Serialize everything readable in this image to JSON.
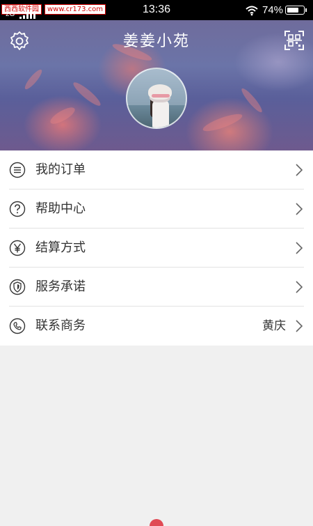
{
  "status_bar": {
    "watermark_badge": "西西软件园",
    "watermark_url": "www.cr173.com",
    "network": "2G",
    "time": "13:36",
    "battery_percent": "74%",
    "battery_level": 0.74
  },
  "header": {
    "title": "姜姜小苑",
    "settings_icon": "gear-icon",
    "scan_icon": "qr-scan-icon"
  },
  "menu": {
    "items": [
      {
        "label": "我的订单",
        "icon": "list-icon",
        "value": ""
      },
      {
        "label": "帮助中心",
        "icon": "question-icon",
        "value": ""
      },
      {
        "label": "结算方式",
        "icon": "yen-icon",
        "value": ""
      },
      {
        "label": "服务承诺",
        "icon": "shield-icon",
        "value": ""
      },
      {
        "label": "联系商务",
        "icon": "phone-icon",
        "value": "黄庆"
      }
    ]
  },
  "colors": {
    "accent": "#e04a54",
    "text": "#333333",
    "background": "#f0f0f0"
  }
}
